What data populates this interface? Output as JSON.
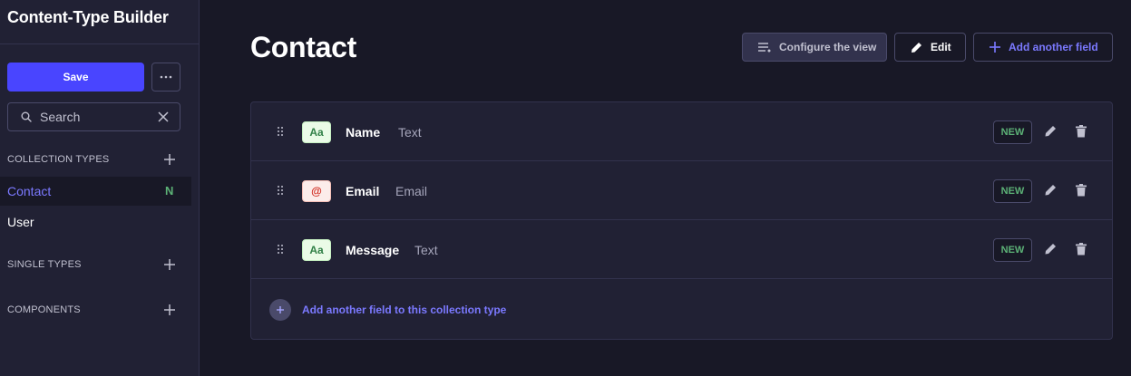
{
  "sidebar": {
    "title": "Content-Type Builder",
    "save_label": "Save",
    "more_label": "···",
    "search_placeholder": "Search",
    "sections": {
      "collection_types": "COLLECTION TYPES",
      "single_types": "SINGLE TYPES",
      "components": "COMPONENTS"
    },
    "collection_items": [
      {
        "label": "Contact",
        "badge": "N",
        "active": true
      },
      {
        "label": "User"
      }
    ]
  },
  "header": {
    "title": "Contact",
    "configure_label": "Configure the view",
    "edit_label": "Edit",
    "add_field_label": "Add another field"
  },
  "fields": [
    {
      "name": "Name",
      "type": "Text",
      "icon": "Aa",
      "badge": "NEW"
    },
    {
      "name": "Email",
      "type": "Email",
      "icon": "@",
      "badge": "NEW"
    },
    {
      "name": "Message",
      "type": "Text",
      "icon": "Aa",
      "badge": "NEW"
    }
  ],
  "add_field_row_label": "Add another field to this collection type",
  "colors": {
    "primary": "#4945ff",
    "link": "#7b79ff",
    "success": "#5cb176",
    "background": "#181826",
    "surface": "#212134"
  }
}
